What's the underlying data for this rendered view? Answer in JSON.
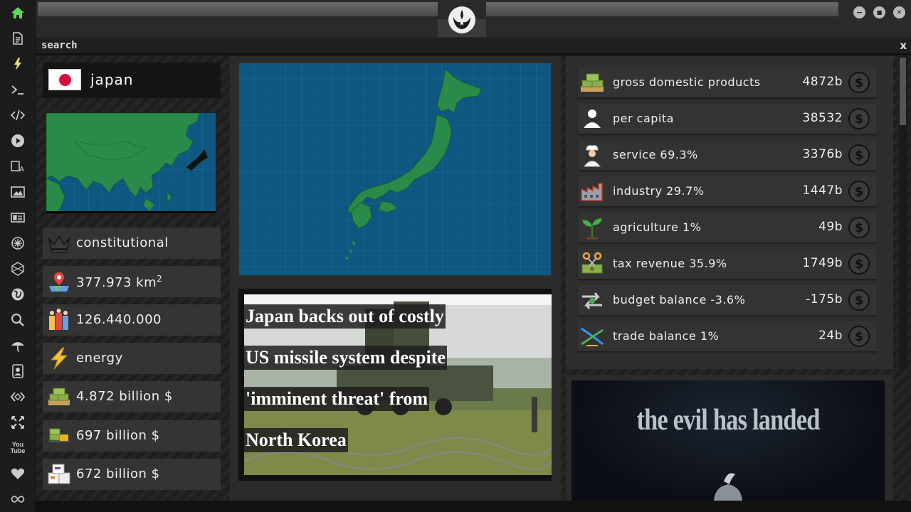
{
  "search": {
    "label": "search",
    "close": "x"
  },
  "window": {
    "minimize": "−",
    "maximize": "■",
    "close": "✕"
  },
  "sidebar": {
    "items": [
      {
        "name": "home"
      },
      {
        "name": "document"
      },
      {
        "name": "lightning"
      },
      {
        "name": "terminal"
      },
      {
        "name": "code"
      },
      {
        "name": "play"
      },
      {
        "name": "translate"
      },
      {
        "name": "image"
      },
      {
        "name": "news"
      },
      {
        "name": "settings-star"
      },
      {
        "name": "hexagon"
      },
      {
        "name": "globe"
      },
      {
        "name": "search"
      },
      {
        "name": "umbrella"
      },
      {
        "name": "contact"
      },
      {
        "name": "diamond-code"
      },
      {
        "name": "expand"
      },
      {
        "name": "youtube"
      },
      {
        "name": "heart"
      },
      {
        "name": "infinity"
      }
    ],
    "youtube_text": "You Tube"
  },
  "country": {
    "name": "japan",
    "government": "constitutional",
    "area_value": "377.973 km",
    "area_sup": "2",
    "population": "126.440.000",
    "category": "energy",
    "gdp": "4.872 billion $",
    "exports": "697 billion $",
    "imports": "672 billion $"
  },
  "news": {
    "headline_lines": [
      " Japan backs out of costly",
      "US missile system despite",
      "'imminent threat' from",
      "North Korea"
    ]
  },
  "economy": {
    "currency_symbol": "$",
    "rows": [
      {
        "label": "gross domestic products",
        "value": "4872b"
      },
      {
        "label": "per capita",
        "value": "38532"
      },
      {
        "label": "service 69.3%",
        "value": "3376b"
      },
      {
        "label": "industry 29.7%",
        "value": "1447b"
      },
      {
        "label": "agriculture 1%",
        "value": "49b"
      },
      {
        "label": "tax revenue 35.9%",
        "value": "1749b"
      },
      {
        "label": "budget balance -3.6%",
        "value": "-175b"
      },
      {
        "label": "trade balance 1%",
        "value": "24b"
      }
    ]
  },
  "promo": {
    "title": "the evil has landed"
  },
  "colors": {
    "map_ocean": "#0d5780",
    "land": "#2a8a4a",
    "accent_green": "#4caf50"
  }
}
